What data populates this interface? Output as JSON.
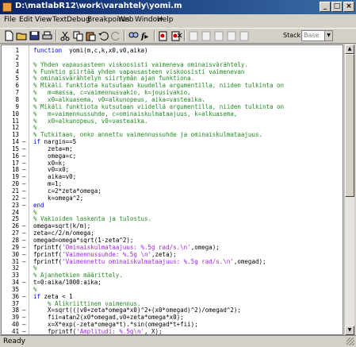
{
  "window": {
    "title": "D:\\matlabR12\\work\\varahtely\\yomi.m",
    "buttons": {
      "minimize": "_",
      "maximize": "□",
      "close": "×"
    }
  },
  "menu": [
    "File",
    "Edit",
    "View",
    "Text",
    "Debug",
    "Breakpoints",
    "Web",
    "Window",
    "Help"
  ],
  "toolbar": {
    "stack_label": "Stack:",
    "stack_value": "Base",
    "icons": [
      "new-file-icon",
      "open-file-icon",
      "save-icon",
      "print-icon",
      "cut-icon",
      "copy-icon",
      "paste-icon",
      "undo-icon",
      "redo-icon",
      "find-icon",
      "function-icon",
      "set-breakpoint-icon",
      "clear-breakpoints-icon",
      "step-icon",
      "step-in-icon",
      "step-out-icon",
      "continue-icon",
      "exit-debug-icon"
    ]
  },
  "editor": {
    "lines": [
      {
        "n": "1",
        "dash": "",
        "segs": [
          [
            "kw",
            "function"
          ],
          [
            "",
            "  yomi(m,c,k,x0,v0,aika)"
          ]
        ]
      },
      {
        "n": "2",
        "dash": "",
        "segs": []
      },
      {
        "n": "3",
        "dash": "",
        "segs": [
          [
            "cm",
            "% Yhden vapausasteen viskoosisti vaimeneva ominaisvärähtely."
          ]
        ]
      },
      {
        "n": "4",
        "dash": "",
        "segs": [
          [
            "cm",
            "% Funktio piirtää yhden vapausasteen viskoosisti vaimenevan"
          ]
        ]
      },
      {
        "n": "5",
        "dash": "",
        "segs": [
          [
            "cm",
            "% ominaisvärähtelyn siirtymän ajan funktiona."
          ]
        ]
      },
      {
        "n": "6",
        "dash": "",
        "segs": [
          [
            "cm",
            "% Mikäli funktiota kutsutaan kuudella argumentilla, niiden tulkinta on"
          ]
        ]
      },
      {
        "n": "7",
        "dash": "",
        "segs": [
          [
            "cm",
            "%   m=massa, c=vaimennusvakio, k=jousivakio,"
          ]
        ]
      },
      {
        "n": "8",
        "dash": "",
        "segs": [
          [
            "cm",
            "%   x0=alkuasema, v0=alkunopeus, aika=vasteaika."
          ]
        ]
      },
      {
        "n": "9",
        "dash": "",
        "segs": [
          [
            "cm",
            "% Mikäli funktiota kutsutaan viidellä argumentilla, niiden tulkinta on"
          ]
        ]
      },
      {
        "n": "10",
        "dash": "",
        "segs": [
          [
            "cm",
            "%   m=vaimennussuhde, c=ominaiskulmataajuus, k=alkuasema,"
          ]
        ]
      },
      {
        "n": "11",
        "dash": "",
        "segs": [
          [
            "cm",
            "%   x0=alkunopeus, v0=vasteaika."
          ]
        ]
      },
      {
        "n": "12",
        "dash": "",
        "segs": [
          [
            "cm",
            "%"
          ]
        ]
      },
      {
        "n": "13",
        "dash": "",
        "segs": [
          [
            "cm",
            "% Tutkitaan, onko annettu vaimennussuhde ja ominaiskulmataajuus."
          ]
        ]
      },
      {
        "n": "14",
        "dash": "–",
        "segs": [
          [
            "kw",
            "if"
          ],
          [
            "",
            " nargin==5"
          ]
        ]
      },
      {
        "n": "15",
        "dash": "–",
        "segs": [
          [
            "",
            "    zeta=m;"
          ]
        ]
      },
      {
        "n": "16",
        "dash": "–",
        "segs": [
          [
            "",
            "    omega=c;"
          ]
        ]
      },
      {
        "n": "17",
        "dash": "–",
        "segs": [
          [
            "",
            "    x0=k;"
          ]
        ]
      },
      {
        "n": "18",
        "dash": "–",
        "segs": [
          [
            "",
            "    v0=x0;"
          ]
        ]
      },
      {
        "n": "19",
        "dash": "–",
        "segs": [
          [
            "",
            "    aika=v0;"
          ]
        ]
      },
      {
        "n": "20",
        "dash": "–",
        "segs": [
          [
            "",
            "    m=1;"
          ]
        ]
      },
      {
        "n": "21",
        "dash": "–",
        "segs": [
          [
            "",
            "    c=2*zeta*omega;"
          ]
        ]
      },
      {
        "n": "22",
        "dash": "–",
        "segs": [
          [
            "",
            "    k=omega^2;"
          ]
        ]
      },
      {
        "n": "23",
        "dash": "–",
        "segs": [
          [
            "kw",
            "end"
          ]
        ]
      },
      {
        "n": "24",
        "dash": "",
        "segs": [
          [
            "cm",
            "%"
          ]
        ]
      },
      {
        "n": "25",
        "dash": "",
        "segs": [
          [
            "cm",
            "% Vakioiden laskenta ja tulostus."
          ]
        ]
      },
      {
        "n": "26",
        "dash": "–",
        "segs": [
          [
            "",
            "omega=sqrt(k/m);"
          ]
        ]
      },
      {
        "n": "27",
        "dash": "–",
        "segs": [
          [
            "",
            "zeta=c/2/m/omega;"
          ]
        ]
      },
      {
        "n": "28",
        "dash": "–",
        "segs": [
          [
            "",
            "omegad=omega*sqrt(1-zeta^2);"
          ]
        ]
      },
      {
        "n": "29",
        "dash": "–",
        "segs": [
          [
            "",
            "fprintf("
          ],
          [
            "st",
            "'Ominaiskulmataajuus: %.5g rad/s.\\n'"
          ],
          [
            "",
            ",omega);"
          ]
        ]
      },
      {
        "n": "30",
        "dash": "–",
        "segs": [
          [
            "",
            "fprintf("
          ],
          [
            "st",
            "'Vaimennussuhde: %.5g \\n'"
          ],
          [
            "",
            ",zeta);"
          ]
        ]
      },
      {
        "n": "31",
        "dash": "–",
        "segs": [
          [
            "",
            "fprintf("
          ],
          [
            "st",
            "'Vaimennettu ominaiskulmataajuus: %.5g rad/s.\\n'"
          ],
          [
            "",
            ",omegad);"
          ]
        ]
      },
      {
        "n": "32",
        "dash": "",
        "segs": [
          [
            "cm",
            "%"
          ]
        ]
      },
      {
        "n": "33",
        "dash": "",
        "segs": [
          [
            "cm",
            "% Ajanhetkien määrittely."
          ]
        ]
      },
      {
        "n": "34",
        "dash": "–",
        "segs": [
          [
            "",
            "t=0:aika/1000:aika;"
          ]
        ]
      },
      {
        "n": "35",
        "dash": "",
        "segs": [
          [
            "cm",
            "%"
          ]
        ]
      },
      {
        "n": "36",
        "dash": "–",
        "segs": [
          [
            "kw",
            "if"
          ],
          [
            "",
            " zeta < 1"
          ]
        ]
      },
      {
        "n": "37",
        "dash": "",
        "segs": [
          [
            "cm",
            "    % Alikriittinen vaimennus."
          ]
        ]
      },
      {
        "n": "38",
        "dash": "–",
        "segs": [
          [
            "",
            "    X=sqrt(((v0+zeta*omega*x0)^2+(x0*omegad)^2)/omegad^2);"
          ]
        ]
      },
      {
        "n": "39",
        "dash": "–",
        "segs": [
          [
            "",
            "    fii=atan2(x0*omegad,v0+zeta*omega*x0);"
          ]
        ]
      },
      {
        "n": "40",
        "dash": "–",
        "segs": [
          [
            "",
            "    x=X*exp(-zeta*omega*t).*sin(omegad*t+fii);"
          ]
        ]
      },
      {
        "n": "41",
        "dash": "–",
        "segs": [
          [
            "",
            "    fprintf("
          ],
          [
            "st",
            "'Amplitudi: %.5g\\n'"
          ],
          [
            "",
            ", X);"
          ]
        ]
      }
    ]
  },
  "status": "Ready"
}
